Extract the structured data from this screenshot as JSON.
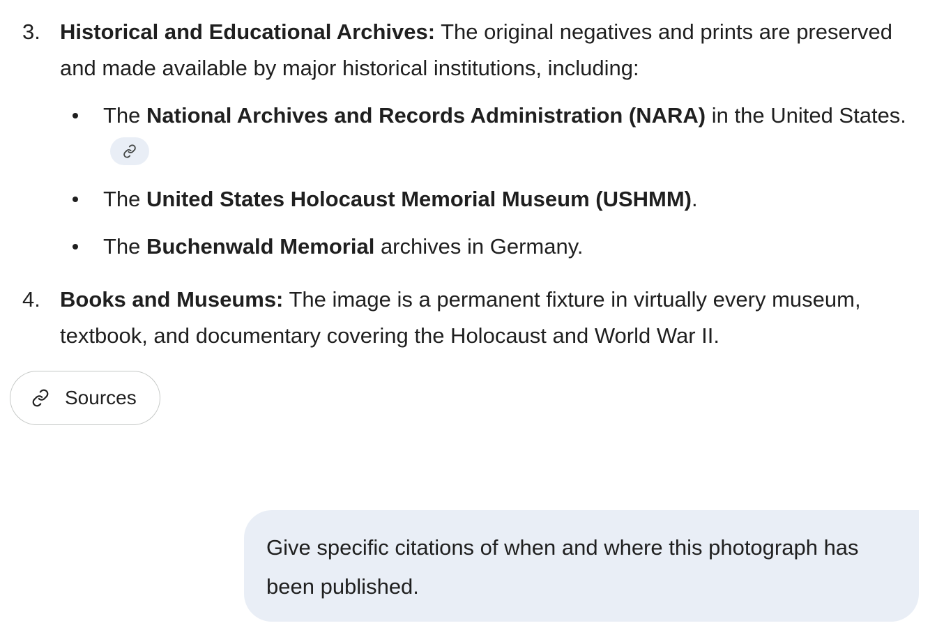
{
  "list": [
    {
      "number": "3.",
      "heading": "Historical and Educational Archives:",
      "text": " The original negatives and prints are preserved and made available by major historical institutions, including:",
      "bullets": [
        {
          "pre": "The ",
          "bold": "National Archives and Records Administration (NARA)",
          "post": " in the United States.",
          "has_citation": true
        },
        {
          "pre": "The ",
          "bold": "United States Holocaust Memorial Museum (USHMM)",
          "post": ".",
          "has_citation": false
        },
        {
          "pre": "The ",
          "bold": "Buchenwald Memorial",
          "post": " archives in Germany.",
          "has_citation": false
        }
      ]
    },
    {
      "number": "4.",
      "heading": "Books and Museums:",
      "text": " The image is a permanent fixture in virtually every museum, textbook, and documentary covering the Holocaust and World War II."
    }
  ],
  "sources_button": {
    "label": "Sources",
    "icon": "link-icon"
  },
  "user_message": {
    "text": "Give specific citations of when and where this photograph has been published."
  },
  "colors": {
    "text": "#1f1f1f",
    "bubble_bg": "#e9eef6",
    "chip_bg": "#e9eef6",
    "button_border": "#c4c7c5"
  }
}
